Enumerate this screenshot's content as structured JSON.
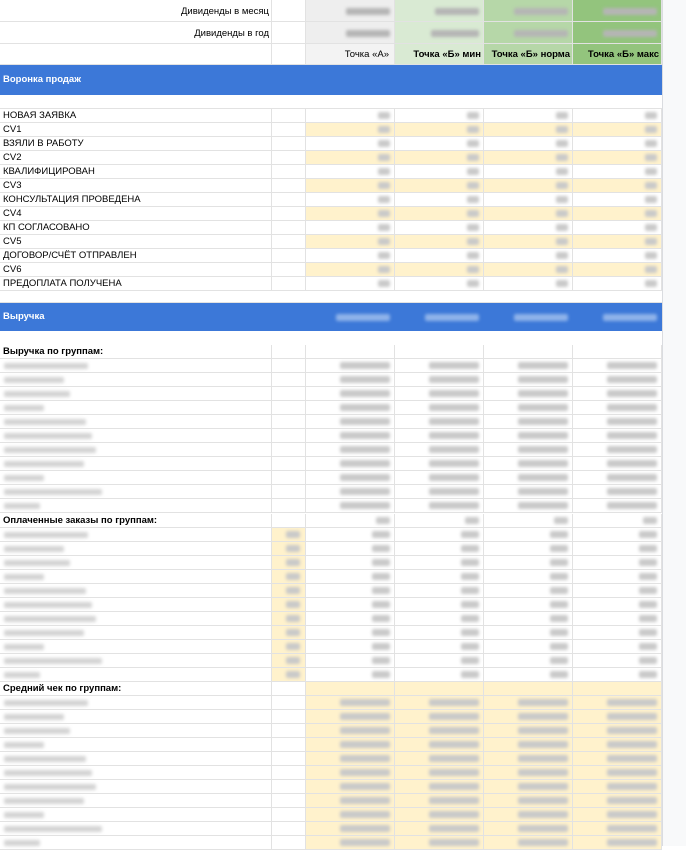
{
  "header": {
    "dividends_month": "Дивиденды в месяц",
    "dividends_year": "Дивиденды в год",
    "col_a": "Точка «А»",
    "col_b_min": "Точка «Б» мин",
    "col_b_norm": "Точка «Б» норма",
    "col_b_max": "Точка «Б» макс"
  },
  "funnel": {
    "title": "Воронка продаж",
    "rows": [
      "НОВАЯ ЗАЯВКА",
      "CV1",
      "ВЗЯЛИ В РАБОТУ",
      "CV2",
      "КВАЛИФИЦИРОВАН",
      "CV3",
      "КОНСУЛЬТАЦИЯ ПРОВЕДЕНА",
      "CV4",
      "КП СОГЛАСОВАНО",
      "CV5",
      "ДОГОВОР/СЧЁТ ОТПРАВЛЕН",
      "CV6",
      "ПРЕДОПЛАТА ПОЛУЧЕНА"
    ]
  },
  "revenue": {
    "title": "Выручка",
    "by_groups": "Выручка по группам:"
  },
  "paid_orders": {
    "title": "Оплаченные заказы по группам:"
  },
  "avg_check": {
    "title": "Средний чек по группам:"
  },
  "colors": {
    "band_blue": "#3c78d8",
    "yellow_fill": "#fff2cc",
    "green_light": "#d9ead3",
    "green_mid": "#b6d7a8",
    "green_dark": "#93c47d"
  }
}
